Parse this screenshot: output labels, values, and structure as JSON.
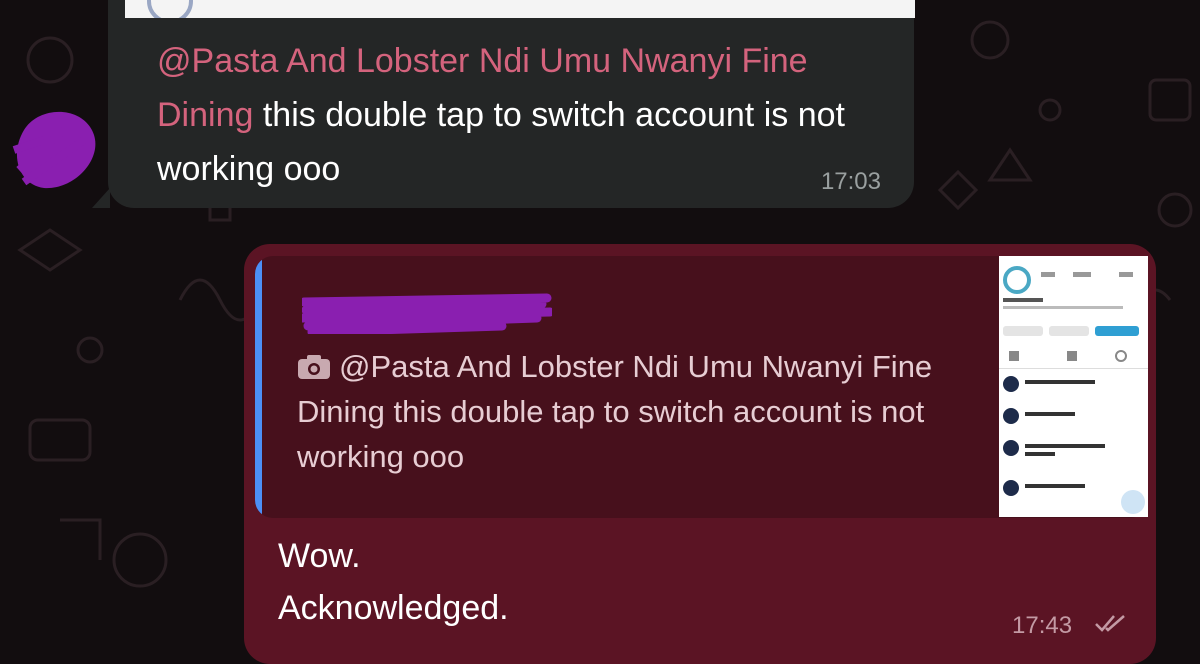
{
  "incoming_message": {
    "mention": "@Pasta And Lobster Ndi Umu Nwanyi Fine Dining",
    "body": "  this double tap to switch account is not working ooo",
    "time": "17:03"
  },
  "outgoing_message": {
    "quoted": {
      "icon": "camera-icon",
      "mention": "@Pasta And Lobster Ndi Umu Nwanyi Fine Dining",
      "body": "  this double tap to switch account is not working ooo"
    },
    "reply_line1": "Wow.",
    "reply_line2": "Acknowledged.",
    "time": "17:43",
    "status_icon": "double-check-icon"
  },
  "colors": {
    "background": "#120d0f",
    "incoming_bubble": "#242626",
    "outgoing_bubble": "#5b1424",
    "quote_bar": "#4c8ff6",
    "mention": "#d4637d",
    "redaction": "#8a1fb0"
  }
}
